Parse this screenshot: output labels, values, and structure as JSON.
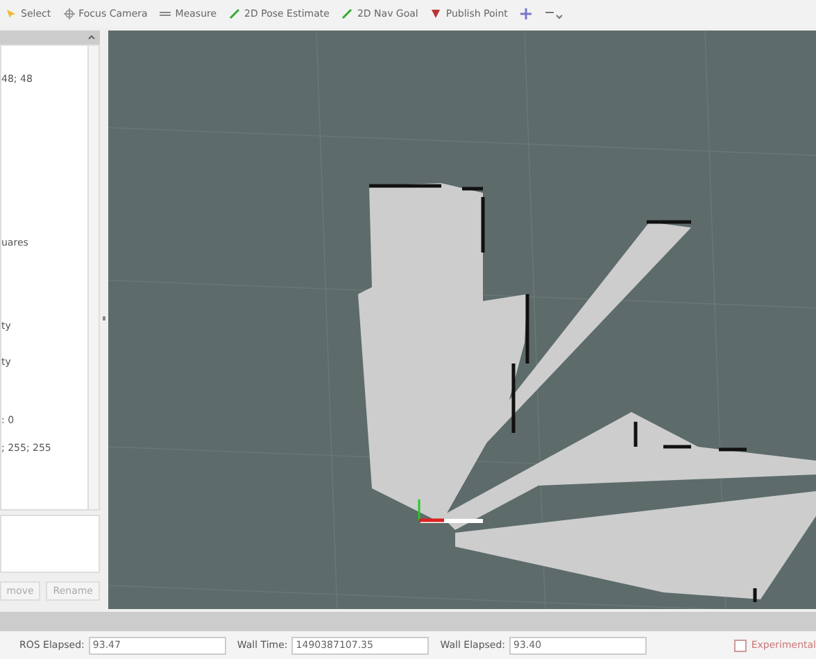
{
  "toolbar": {
    "tools": [
      {
        "label": "Select",
        "kind": "select"
      },
      {
        "label": "Focus Camera",
        "kind": "focus"
      },
      {
        "label": "Measure",
        "kind": "measure"
      },
      {
        "label": "2D Pose Estimate",
        "kind": "pose"
      },
      {
        "label": "2D Nav Goal",
        "kind": "goal"
      },
      {
        "label": "Publish Point",
        "kind": "point"
      }
    ]
  },
  "side_panel": {
    "lines": [
      "48; 48",
      "uares",
      "ty",
      "ty",
      ": 0",
      "; 255; 255"
    ],
    "buttons": [
      "move",
      "Rename"
    ]
  },
  "status_bar": {
    "fields": [
      {
        "label": "ROS Elapsed:",
        "value": "93.47"
      },
      {
        "label": "Wall Time:",
        "value": "1490387107.35"
      },
      {
        "label": "Wall Elapsed:",
        "value": "93.40"
      }
    ],
    "experimental": {
      "label": "Experimental",
      "checked": false
    }
  }
}
